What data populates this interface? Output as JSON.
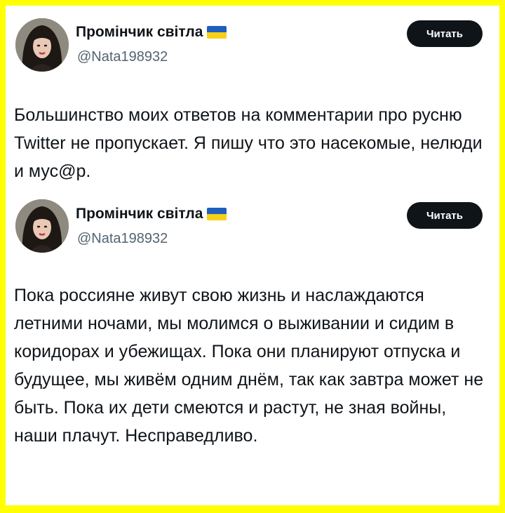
{
  "tweets": [
    {
      "display_name": "Промінчик світла",
      "handle": "@Nata198932",
      "read_button": "Читать",
      "text": "Большинство моих ответов на комментарии про русню Twitter не пропускает. Я пишу что это насекомые, нелюди и мус@р."
    },
    {
      "display_name": "Промінчик світла",
      "handle": "@Nata198932",
      "read_button": "Читать",
      "text": "Пока россияне живут свою жизнь и наслаждаются летними ночами, мы молимся о выживании и сидим в коридорах и убежищах. Пока они планируют отпуска и будущее, мы живём одним днём, так как завтра может не быть. Пока их дети смеются и растут, не зная войны, наши плачут. Несправедливо."
    }
  ],
  "colors": {
    "frame": "#ffff00",
    "card": "#ffffff",
    "button_bg": "#0f1419",
    "handle_text": "#536471",
    "flag_blue": "#1f5fbf",
    "flag_yellow": "#f7d117"
  },
  "icons": {
    "flag": "ukraine-flag-icon",
    "avatar": "profile-photo"
  }
}
